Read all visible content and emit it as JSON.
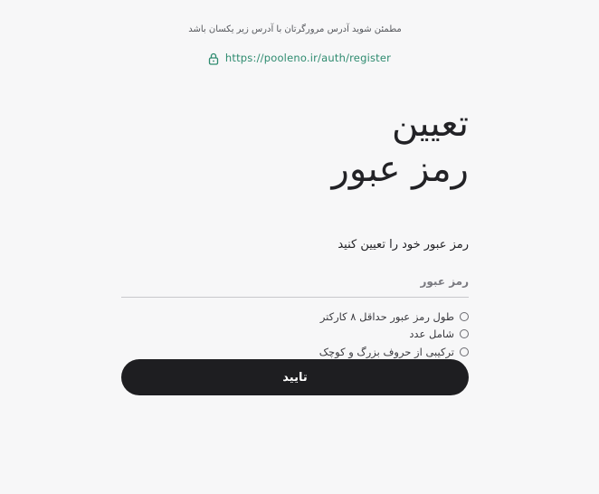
{
  "notice": {
    "text": "مطمئن شوید آدرس مرورگرتان با آدرس زیر یکسان باشد"
  },
  "address": {
    "icon": "lock-icon",
    "url": "https://pooleno.ir/auth/register",
    "color": "#2e8b6f"
  },
  "title": {
    "line1": "تعیین",
    "line2": "رمز عبور"
  },
  "form": {
    "subtitle": "رمز عبور خود را تعیین کنید",
    "password_placeholder": "رمز عبور",
    "password_value": "",
    "rules": [
      {
        "label": "طول رمز عبور حداقل ۸ کارکتر",
        "checked": false
      },
      {
        "label": "شامل عدد",
        "checked": false
      },
      {
        "label": "ترکیبی از حروف بزرگ و کوچک",
        "checked": false
      }
    ],
    "submit_label": "تایید"
  },
  "colors": {
    "background": "#f7f7f8",
    "button": "#1e1e21",
    "text": "#222226"
  }
}
